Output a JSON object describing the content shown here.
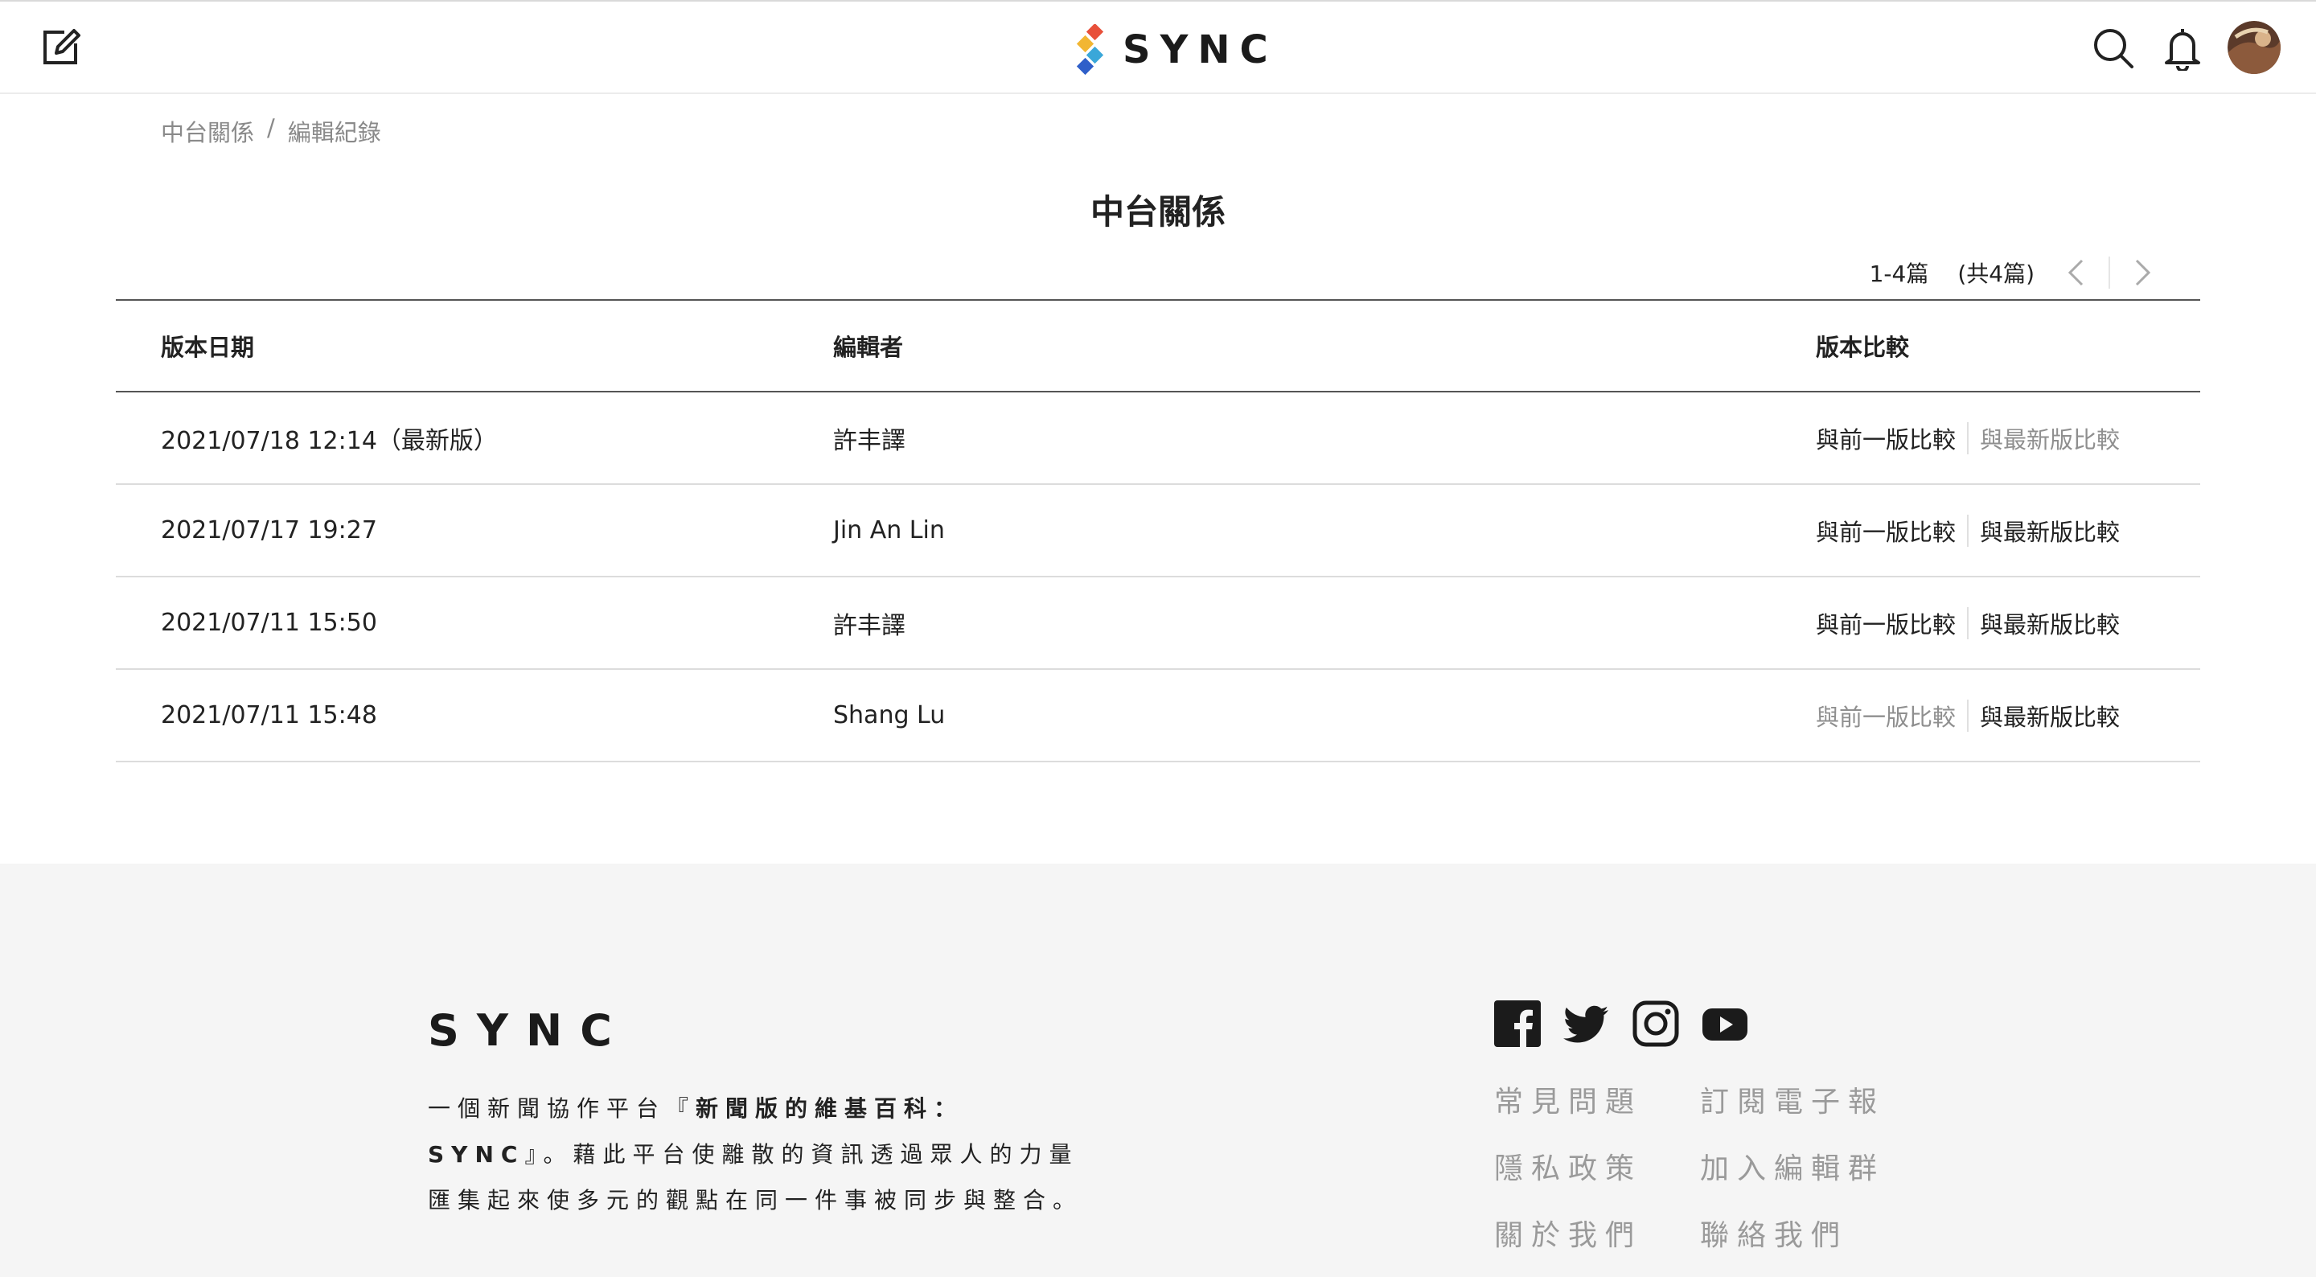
{
  "header": {
    "brand": "SYNC",
    "logo_colors": [
      "#e8503a",
      "#f2b632",
      "#3aa7d9",
      "#2f5fc9"
    ]
  },
  "breadcrumb": {
    "items": [
      "中台關係",
      "編輯紀錄"
    ],
    "separator": "/"
  },
  "page_title": "中台關係",
  "pager": {
    "range": "1-4篇",
    "total": "(共4篇)"
  },
  "table": {
    "headers": [
      "版本日期",
      "編輯者",
      "版本比較"
    ],
    "rows": [
      {
        "date": "2021/07/18 12:14（最新版）",
        "editor": "許丰譯",
        "prev": "與前一版比較",
        "latest": "與最新版比較",
        "prev_enabled": true,
        "latest_enabled": false
      },
      {
        "date": "2021/07/17 19:27",
        "editor": "Jin An Lin",
        "prev": "與前一版比較",
        "latest": "與最新版比較",
        "prev_enabled": true,
        "latest_enabled": true
      },
      {
        "date": "2021/07/11 15:50",
        "editor": "許丰譯",
        "prev": "與前一版比較",
        "latest": "與最新版比較",
        "prev_enabled": true,
        "latest_enabled": true
      },
      {
        "date": "2021/07/11 15:48",
        "editor": "Shang Lu",
        "prev": "與前一版比較",
        "latest": "與最新版比較",
        "prev_enabled": false,
        "latest_enabled": true
      }
    ]
  },
  "footer": {
    "brand": "SYNC",
    "desc_prefix": "一個新聞協作平台『",
    "desc_bold": "新聞版的維基百科：SYNC",
    "desc_suffix": "』。藉此平台使離散的資訊透過眾人的力量匯集起來使多元的觀點在同一件事被同步與整合。",
    "social": [
      "facebook-icon",
      "twitter-icon",
      "instagram-icon",
      "youtube-icon"
    ],
    "links": [
      "常見問題",
      "訂閱電子報",
      "隱私政策",
      "加入編輯群",
      "關於我們",
      "聯絡我們"
    ]
  }
}
